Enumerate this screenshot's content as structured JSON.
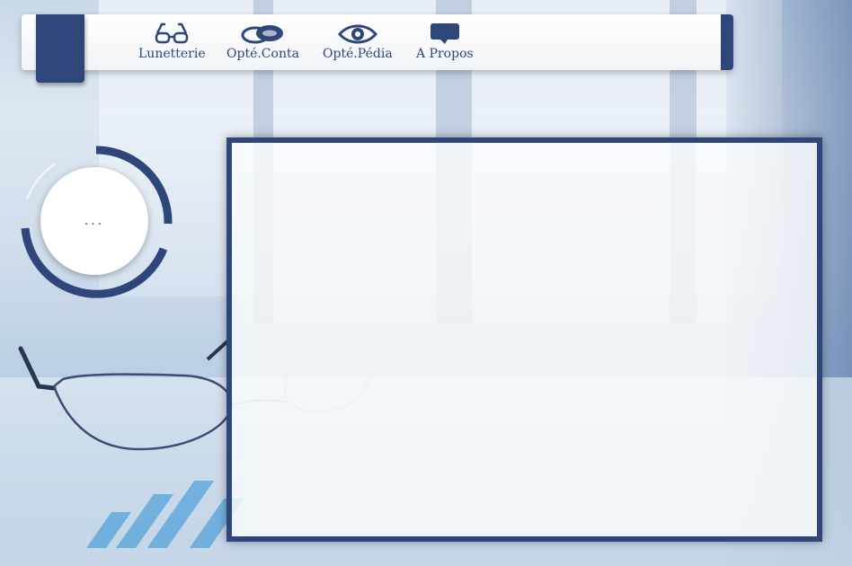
{
  "nav": {
    "items": [
      {
        "label": "Lunetterie",
        "icon": "eyeglasses-icon"
      },
      {
        "label": "Opté.Conta",
        "icon": "contact-lenses-icon"
      },
      {
        "label": "Opté.Pédia",
        "icon": "eye-icon"
      },
      {
        "label": "A Propos",
        "icon": "speech-bubble-icon"
      }
    ]
  },
  "loader": {
    "text": "..."
  },
  "colors": {
    "accent": "#2e467a",
    "loader_dots": "#7a2b6f"
  }
}
